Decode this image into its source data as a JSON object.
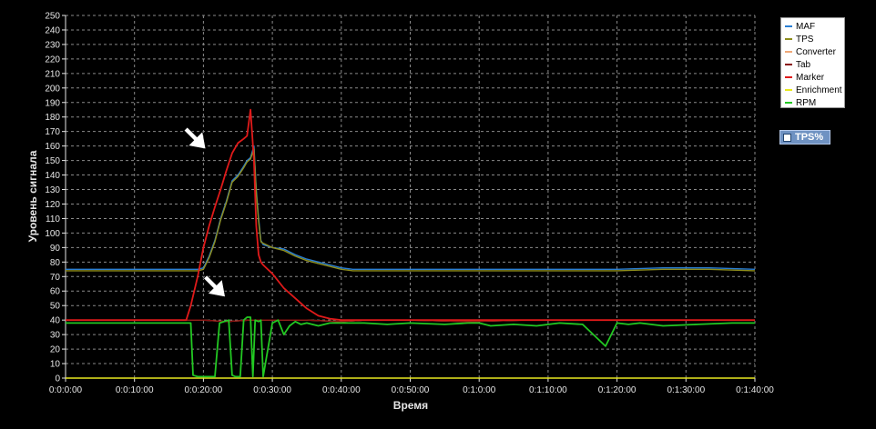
{
  "chart_data": {
    "type": "line",
    "title": "",
    "xlabel": "Время",
    "ylabel": "Уровень сигнала",
    "xlim": [
      0,
      6000
    ],
    "ylim": [
      0,
      250
    ],
    "x_tick_labels": [
      "0:0:0:00",
      "0:0:10:00",
      "0:0:20:00",
      "0:0:30:00",
      "0:0:40:00",
      "0:0:50:00",
      "0:1:0:00",
      "0:1:10:00",
      "0:1:20:00",
      "0:1:30:00",
      "0:1:40:00"
    ],
    "y_ticks": [
      0,
      10,
      20,
      30,
      40,
      50,
      60,
      70,
      80,
      90,
      100,
      110,
      120,
      130,
      140,
      150,
      160,
      170,
      180,
      190,
      200,
      210,
      220,
      230,
      240,
      250
    ],
    "grid": true,
    "legend_position": "top-right",
    "series": [
      {
        "name": "MAF",
        "color": "#2a7fd4",
        "x": [
          0,
          600,
          900,
          1050,
          1150,
          1200,
          1250,
          1300,
          1350,
          1400,
          1450,
          1500,
          1550,
          1580,
          1610,
          1640,
          1660,
          1680,
          1700,
          1720,
          1800,
          1900,
          2000,
          2100,
          2200,
          2300,
          2400,
          2500,
          2600,
          2800,
          3000,
          3300,
          3600,
          4000,
          4400,
          4800,
          5200,
          5600,
          6000
        ],
        "y": [
          75,
          75,
          75,
          75,
          75,
          76,
          84,
          95,
          110,
          122,
          136,
          140,
          146,
          150,
          152,
          160,
          130,
          110,
          95,
          92,
          90,
          89,
          85,
          82,
          80,
          78,
          76,
          75,
          75,
          75,
          75,
          75,
          75,
          75,
          75,
          75,
          76,
          76,
          75
        ]
      },
      {
        "name": "TPS",
        "color": "#8e8e1e",
        "x": [
          0,
          600,
          900,
          1050,
          1150,
          1200,
          1250,
          1300,
          1350,
          1400,
          1450,
          1500,
          1550,
          1580,
          1610,
          1640,
          1660,
          1680,
          1700,
          1720,
          1800,
          1900,
          2000,
          2100,
          2200,
          2300,
          2400,
          2500,
          2600,
          2800,
          3000,
          3300,
          3600,
          4000,
          4400,
          4800,
          5200,
          5600,
          6000
        ],
        "y": [
          74,
          74,
          74,
          74,
          74,
          75,
          83,
          94,
          109,
          121,
          135,
          139,
          145,
          149,
          151,
          158,
          128,
          108,
          94,
          93,
          90,
          88,
          84,
          81,
          79,
          77,
          75,
          74,
          74,
          74,
          74,
          74,
          74,
          74,
          74,
          74,
          75,
          75,
          74
        ]
      },
      {
        "name": "Converter",
        "color": "#f0a878",
        "x": [
          0,
          600,
          900,
          1050,
          1200,
          1400,
          1600,
          1800,
          2100,
          2400,
          2600,
          3000,
          3500,
          4000,
          4500,
          5000,
          5500,
          6000
        ],
        "y": [
          40,
          40,
          40,
          40,
          40,
          39,
          40,
          40,
          40,
          39,
          40,
          40,
          39,
          40,
          40,
          40,
          40,
          40
        ]
      },
      {
        "name": "Tab",
        "color": "#8a1010",
        "x": [
          0,
          600,
          900,
          1050,
          1200,
          1400,
          1600,
          1800,
          2100,
          2400,
          2600,
          3000,
          3500,
          4000,
          4500,
          5000,
          5500,
          6000
        ],
        "y": [
          40,
          40,
          40,
          40,
          40,
          39,
          40,
          40,
          40,
          39,
          40,
          40,
          39,
          40,
          40,
          40,
          40,
          40
        ]
      },
      {
        "name": "Marker",
        "color": "#e01a1a",
        "x": [
          0,
          600,
          900,
          1050,
          1090,
          1150,
          1200,
          1250,
          1300,
          1350,
          1400,
          1450,
          1500,
          1550,
          1580,
          1610,
          1640,
          1660,
          1680,
          1700,
          1720,
          1800,
          1900,
          2000,
          2100,
          2200,
          2300,
          2400,
          2500,
          2600,
          2800,
          3000,
          3300,
          3600,
          4000,
          4400,
          4800,
          5200,
          5600,
          6000
        ],
        "y": [
          40,
          40,
          40,
          40,
          50,
          70,
          90,
          105,
          118,
          130,
          143,
          155,
          162,
          165,
          167,
          185,
          150,
          105,
          85,
          80,
          78,
          72,
          62,
          55,
          48,
          43,
          41,
          40,
          40,
          40,
          40,
          40,
          40,
          40,
          40,
          40,
          40,
          40,
          40,
          40
        ]
      },
      {
        "name": "Enrichment",
        "color": "#e8e820",
        "x": [
          0,
          6000
        ],
        "y": [
          0,
          0
        ]
      },
      {
        "name": "RPM",
        "color": "#22c822",
        "x": [
          0,
          600,
          900,
          1050,
          1090,
          1110,
          1150,
          1200,
          1260,
          1300,
          1340,
          1380,
          1420,
          1450,
          1480,
          1520,
          1550,
          1580,
          1610,
          1630,
          1650,
          1680,
          1700,
          1720,
          1800,
          1850,
          1900,
          1950,
          2000,
          2050,
          2100,
          2200,
          2300,
          2400,
          2600,
          2800,
          3000,
          3300,
          3500,
          3600,
          3700,
          3900,
          4100,
          4300,
          4500,
          4700,
          4800,
          4900,
          5000,
          5200,
          5500,
          5800,
          6000
        ],
        "y": [
          38,
          38,
          38,
          38,
          38,
          2,
          1,
          1,
          1,
          1,
          38,
          39,
          40,
          2,
          1,
          1,
          40,
          42,
          42,
          1,
          40,
          39,
          40,
          1,
          38,
          40,
          30,
          36,
          39,
          37,
          38,
          36,
          38,
          38,
          38,
          37,
          38,
          37,
          38,
          38,
          36,
          37,
          36,
          38,
          37,
          22,
          38,
          37,
          38,
          36,
          37,
          38,
          38
        ]
      }
    ],
    "annotations": [
      {
        "type": "arrow",
        "x": 1220,
        "y": 158
      },
      {
        "type": "arrow",
        "x": 1390,
        "y": 56
      }
    ]
  },
  "legend": {
    "items": [
      {
        "label": "MAF",
        "color": "#2a7fd4"
      },
      {
        "label": "TPS",
        "color": "#8e8e1e"
      },
      {
        "label": "Converter",
        "color": "#f0a878"
      },
      {
        "label": "Tab",
        "color": "#8a1010"
      },
      {
        "label": "Marker",
        "color": "#e01a1a"
      },
      {
        "label": "Enrichment",
        "color": "#e8e820"
      },
      {
        "label": "RPM",
        "color": "#22c822"
      }
    ]
  },
  "side_panel": {
    "tps_label": "TPS%",
    "icon": "checkbox-icon"
  },
  "colors": {
    "background": "#000000",
    "grid": "#8a8a8a",
    "axis": "#e6e6e6",
    "panel_accent": "#6f92c2"
  }
}
